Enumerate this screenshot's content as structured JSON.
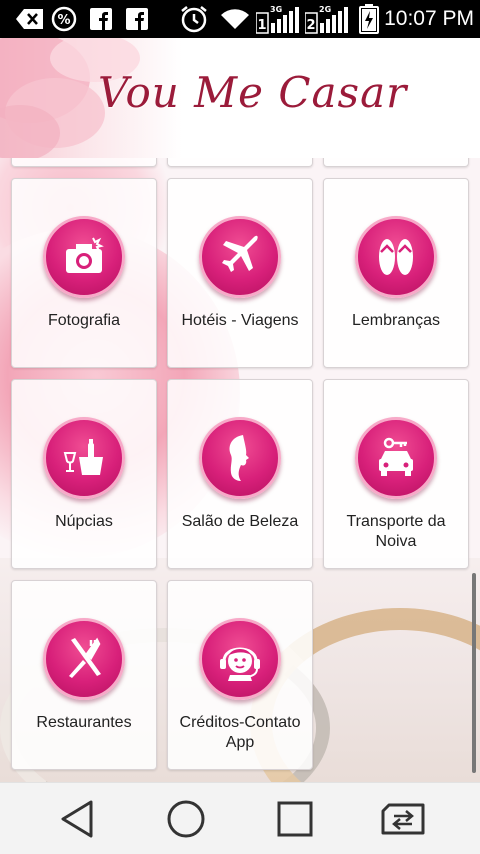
{
  "status_bar": {
    "time": "10:07 PM",
    "badge_3g": "3G",
    "badge_2g": "2G",
    "sim_1": "1",
    "sim_2": "2",
    "icons": [
      "back-arrow-icon",
      "percent-icon",
      "facebook-icon",
      "facebook-icon",
      "alarm-icon",
      "wifi-icon",
      "signal-3g-icon",
      "signal-2g-icon",
      "battery-charging-icon"
    ]
  },
  "header": {
    "title": "Vou Me Casar"
  },
  "tiles": [
    {
      "label": "Fotografia",
      "icon": "camera-icon"
    },
    {
      "label": "Hotéis - Viagens",
      "icon": "airplane-icon"
    },
    {
      "label": "Lembranças",
      "icon": "flip-flops-icon"
    },
    {
      "label": "Núpcias",
      "icon": "champagne-icon"
    },
    {
      "label": "Salão de Beleza",
      "icon": "woman-profile-icon"
    },
    {
      "label": "Transporte da Noiva",
      "icon": "car-key-icon"
    },
    {
      "label": "Restaurantes",
      "icon": "fork-knife-icon"
    },
    {
      "label": "Créditos-Contato App",
      "icon": "support-headset-icon"
    }
  ],
  "nav_bar": {
    "icons": [
      "back-triangle-icon",
      "home-circle-icon",
      "recents-square-icon",
      "switch-sim-icon"
    ]
  },
  "colors": {
    "icon_circle": "#d8207a",
    "icon_ring": "#f7a9c8",
    "title": "#9b1b3a",
    "status_bar": "#000000"
  }
}
